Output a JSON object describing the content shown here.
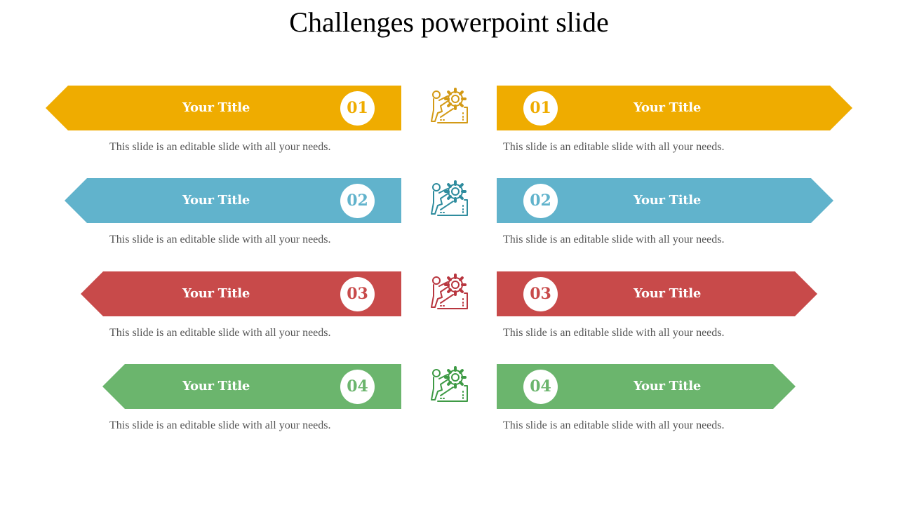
{
  "slide": {
    "title": "Challenges powerpoint slide"
  },
  "colors": {
    "yellow": "#EFAC00",
    "blue": "#61B3CC",
    "red": "#C84A4A",
    "green": "#6BB56D",
    "icon_yellow": "#D39A16",
    "icon_blue": "#2F8C9E",
    "icon_red": "#B8363F",
    "icon_green": "#3E9A45"
  },
  "rows": [
    {
      "number": "01",
      "color_key": "yellow",
      "left": {
        "title": "Your Title",
        "number": "01",
        "description": "This slide is an editable slide with all your needs."
      },
      "right": {
        "title": "Your Title",
        "number": "01",
        "description": "This slide is an editable slide with all your needs."
      },
      "icon": "climber-gear-icon"
    },
    {
      "number": "02",
      "color_key": "blue",
      "left": {
        "title": "Your Title",
        "number": "02",
        "description": "This slide is an editable slide with all your needs."
      },
      "right": {
        "title": "Your Title",
        "number": "02",
        "description": "This slide is an editable slide with all your needs."
      },
      "icon": "climber-gear-icon"
    },
    {
      "number": "03",
      "color_key": "red",
      "left": {
        "title": "Your Title",
        "number": "03",
        "description": "This slide is an editable slide with all your needs."
      },
      "right": {
        "title": "Your Title",
        "number": "03",
        "description": "This slide is an editable slide with all your needs."
      },
      "icon": "climber-gear-icon"
    },
    {
      "number": "04",
      "color_key": "green",
      "left": {
        "title": "Your Title",
        "number": "04",
        "description": "This slide is an editable slide with all your needs."
      },
      "right": {
        "title": "Your Title",
        "number": "04",
        "description": "This slide is an editable slide with all your needs."
      },
      "icon": "climber-gear-icon"
    }
  ]
}
